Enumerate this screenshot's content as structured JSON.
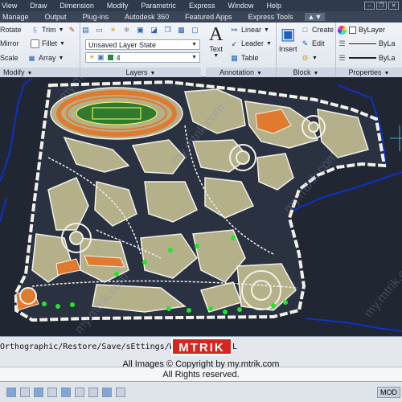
{
  "menu": {
    "items": [
      "View",
      "Draw",
      "Dimension",
      "Modify",
      "Parametric",
      "Express",
      "Window",
      "Help",
      "Manage",
      "Output",
      "Plug-ins",
      "Autodesk 360",
      "Featured Apps",
      "Express Tools"
    ]
  },
  "ribbon": {
    "modify": {
      "title": "Modify",
      "rotate": "Rotate",
      "trim": "Trim",
      "mirror": "Mirror",
      "fillet": "Fillet",
      "scale": "Scale",
      "array": "Array"
    },
    "layers": {
      "title": "Layers",
      "layer_state": "Unsaved Layer State",
      "current_layer": "4"
    },
    "annotation": {
      "title": "Annotation",
      "text": "Text",
      "linear": "Linear",
      "leader": "Leader",
      "table": "Table"
    },
    "block": {
      "title": "Block",
      "insert": "Insert",
      "create": "Create",
      "edit": "Edit"
    },
    "properties": {
      "title": "Properties",
      "color": "ByLayer",
      "linetype": "ByLa",
      "lineweight": "ByLa"
    }
  },
  "command_line": {
    "text": "Orthographic/Restore/Save/sEttings/Window]: _SHEL"
  },
  "watermark": {
    "logo": "MTRIK",
    "line1": "All Images © Copyright by my.mtrik.com",
    "line2": "All Rights reserved.",
    "diagonal": "my.mtrik.com"
  },
  "status": {
    "mode": "MOD"
  },
  "colors": {
    "canvas": "#202632",
    "land": "#b3b08a",
    "outline": "#f2f2ea",
    "track": "#e07a2e",
    "field": "#2f7a2c",
    "boundary": "#1030c8",
    "tree": "#21e62a"
  }
}
